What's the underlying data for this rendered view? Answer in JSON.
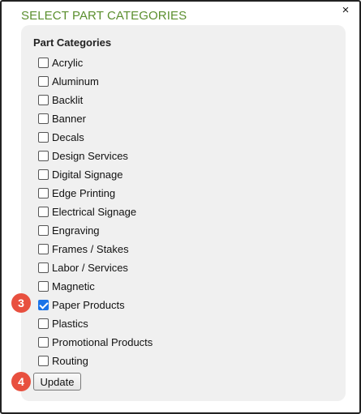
{
  "dialog": {
    "title": "SELECT PART CATEGORIES",
    "close_icon": "close-icon",
    "close_glyph": "×"
  },
  "panel": {
    "heading": "Part Categories",
    "categories": [
      {
        "label": "Acrylic",
        "checked": false
      },
      {
        "label": "Aluminum",
        "checked": false
      },
      {
        "label": "Backlit",
        "checked": false
      },
      {
        "label": "Banner",
        "checked": false
      },
      {
        "label": "Decals",
        "checked": false
      },
      {
        "label": "Design Services",
        "checked": false
      },
      {
        "label": "Digital Signage",
        "checked": false
      },
      {
        "label": "Edge Printing",
        "checked": false
      },
      {
        "label": "Electrical Signage",
        "checked": false
      },
      {
        "label": "Engraving",
        "checked": false
      },
      {
        "label": "Frames / Stakes",
        "checked": false
      },
      {
        "label": "Labor / Services",
        "checked": false
      },
      {
        "label": "Magnetic",
        "checked": false
      },
      {
        "label": "Paper Products",
        "checked": true
      },
      {
        "label": "Plastics",
        "checked": false
      },
      {
        "label": "Promotional Products",
        "checked": false
      },
      {
        "label": "Routing",
        "checked": false
      }
    ],
    "update_label": "Update"
  },
  "annotations": {
    "step_checkbox": "3",
    "step_update": "4"
  },
  "colors": {
    "title": "#5b8f2e",
    "panel_bg": "#f0f0f0",
    "badge": "#e8503f",
    "checkbox_checked": "#1a73e8"
  }
}
